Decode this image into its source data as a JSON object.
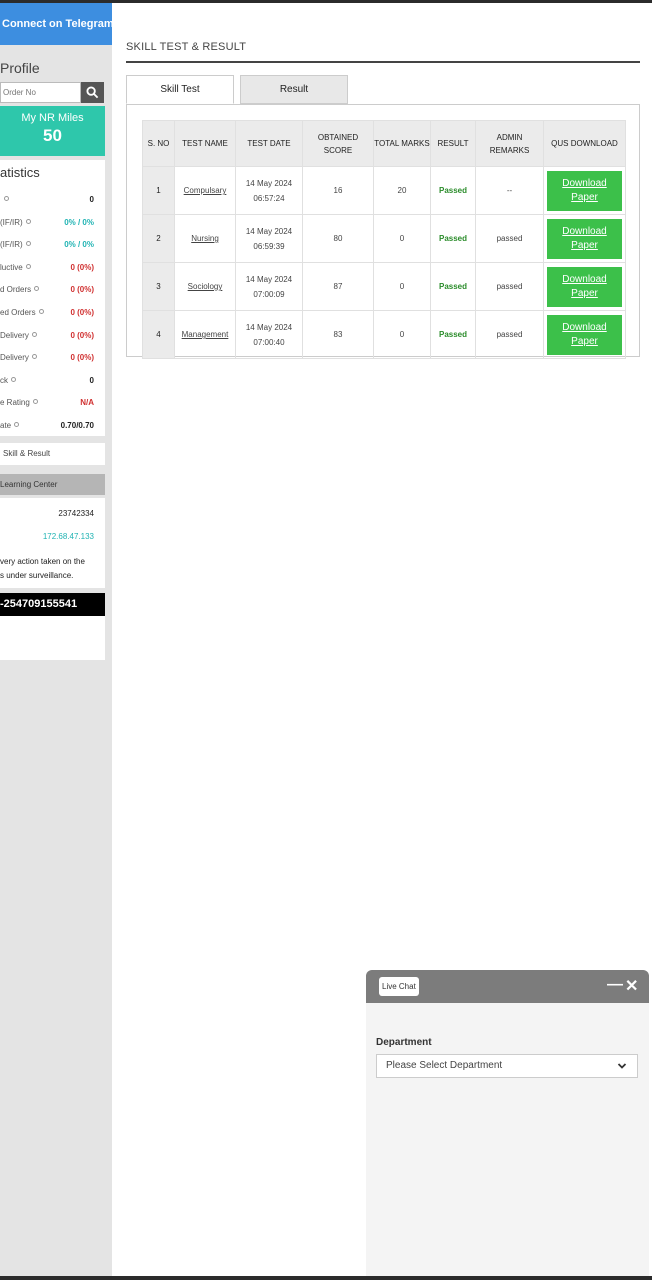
{
  "sidebar": {
    "telegram_label": "Connect on Telegram",
    "profile_title": "Profile",
    "order_placeholder": "Order No",
    "miles_label": "My NR Miles",
    "miles_value": "50",
    "stats_title": "atistics",
    "stats": [
      {
        "label": "",
        "value": "0",
        "color": "black"
      },
      {
        "label": "(IF/IR)",
        "value": "0% / 0%",
        "color": "teal"
      },
      {
        "label": "(IF/IR)",
        "value": "0% / 0%",
        "color": "teal"
      },
      {
        "label": "luctive",
        "value": "0 (0%)",
        "color": "red"
      },
      {
        "label": "d Orders",
        "value": "0 (0%)",
        "color": "red"
      },
      {
        "label": "ed Orders",
        "value": "0 (0%)",
        "color": "red"
      },
      {
        "label": "Delivery",
        "value": "0 (0%)",
        "color": "red"
      },
      {
        "label": "Delivery",
        "value": "0 (0%)",
        "color": "red"
      },
      {
        "label": "ck",
        "value": "0",
        "color": "black"
      },
      {
        "label": "e Rating",
        "value": "N/A",
        "color": "red"
      },
      {
        "label": "ate",
        "value": "0.70/0.70",
        "color": "black"
      }
    ],
    "skill_result_link": "Skill & Result",
    "learning_center": "Learning Center",
    "info_number": "23742334",
    "info_ip": "172.68.47.133",
    "note_line1": "very action taken on the",
    "note_line2": "s under surveillance.",
    "phone": "-254709155541"
  },
  "main": {
    "page_title": "SKILL TEST & RESULT",
    "tabs": [
      {
        "label": "Skill Test",
        "active": true
      },
      {
        "label": "Result",
        "active": false
      }
    ],
    "table": {
      "headers": [
        "S. NO",
        "TEST NAME",
        "TEST DATE",
        "OBTAINED SCORE",
        "TOTAL MARKS",
        "RESULT",
        "ADMIN REMARKS",
        "QUS DOWNLOAD"
      ],
      "rows": [
        {
          "sno": "1",
          "name": "Compulsary",
          "date": "14 May 2024",
          "time": "06:57:24",
          "score": "16",
          "total": "20",
          "result": "Passed",
          "remarks": "--",
          "download": "Download Paper"
        },
        {
          "sno": "2",
          "name": "Nursing",
          "date": "14 May 2024",
          "time": "06:59:39",
          "score": "80",
          "total": "0",
          "result": "Passed",
          "remarks": "passed",
          "download": "Download Paper"
        },
        {
          "sno": "3",
          "name": "Sociology",
          "date": "14 May 2024",
          "time": "07:00:09",
          "score": "87",
          "total": "0",
          "result": "Passed",
          "remarks": "passed",
          "download": "Download Paper"
        },
        {
          "sno": "4",
          "name": "Management",
          "date": "14 May 2024",
          "time": "07:00:40",
          "score": "83",
          "total": "0",
          "result": "Passed",
          "remarks": "passed",
          "download": "Download Paper"
        }
      ]
    }
  },
  "chat": {
    "title": "Live Chat",
    "minimize": "—",
    "close": "✕",
    "department_label": "Department",
    "department_select": "Please Select Department"
  },
  "colors": {
    "telegram": "#3d8ee0",
    "miles": "#2ec7ab",
    "download": "#3cc04a",
    "passed": "#2a8c2a"
  }
}
